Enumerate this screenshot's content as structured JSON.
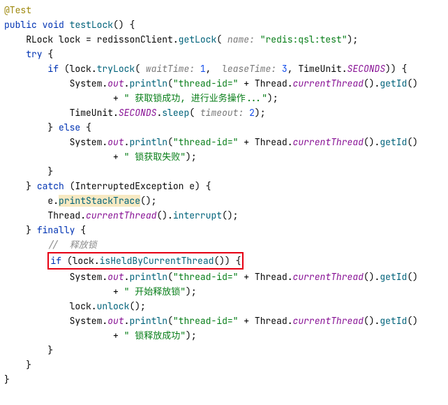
{
  "annotation": "@Test",
  "sig": {
    "mods": "public",
    "ret": "void",
    "name": "testLock",
    "params": "()"
  },
  "l1": {
    "type": "RLock",
    "var": "lock",
    "expr1": "redissonClient.",
    "call": "getLock",
    "hint": "name:",
    "str": "\"redis:qsl:test\""
  },
  "try": "try",
  "if": "if",
  "else": "else",
  "catch": "catch",
  "finally": "finally",
  "tryLock": {
    "call": "tryLock",
    "h1": "waitTime:",
    "v1": "1",
    "h2": "leaseTime:",
    "v2": "3",
    "tu": "TimeUnit",
    "sec": "SECONDS"
  },
  "sys": "System",
  "out": "out",
  "println": "println",
  "strThreadId": "\"thread-id=\"",
  "thread": "Thread",
  "curThread": "currentThread",
  "getId": "getId",
  "strSuccess": "\" 获取锁成功, 进行业务操作...\"",
  "sleep": {
    "tu": "TimeUnit",
    "sec": "SECONDS",
    "call": "sleep",
    "hint": "timeout:",
    "v": "2"
  },
  "strFail": "\" 锁获取失败\"",
  "exc": {
    "type": "InterruptedException",
    "var": "e",
    "pst": "printStackTrace",
    "ct": "currentThread",
    "intr": "interrupt"
  },
  "cmtRelease": "//  释放锁",
  "isHeld": "isHeldByCurrentThread",
  "strStartRel": "\" 开始释放锁\"",
  "unlock": "unlock",
  "strRelOk": "\" 锁释放成功\""
}
